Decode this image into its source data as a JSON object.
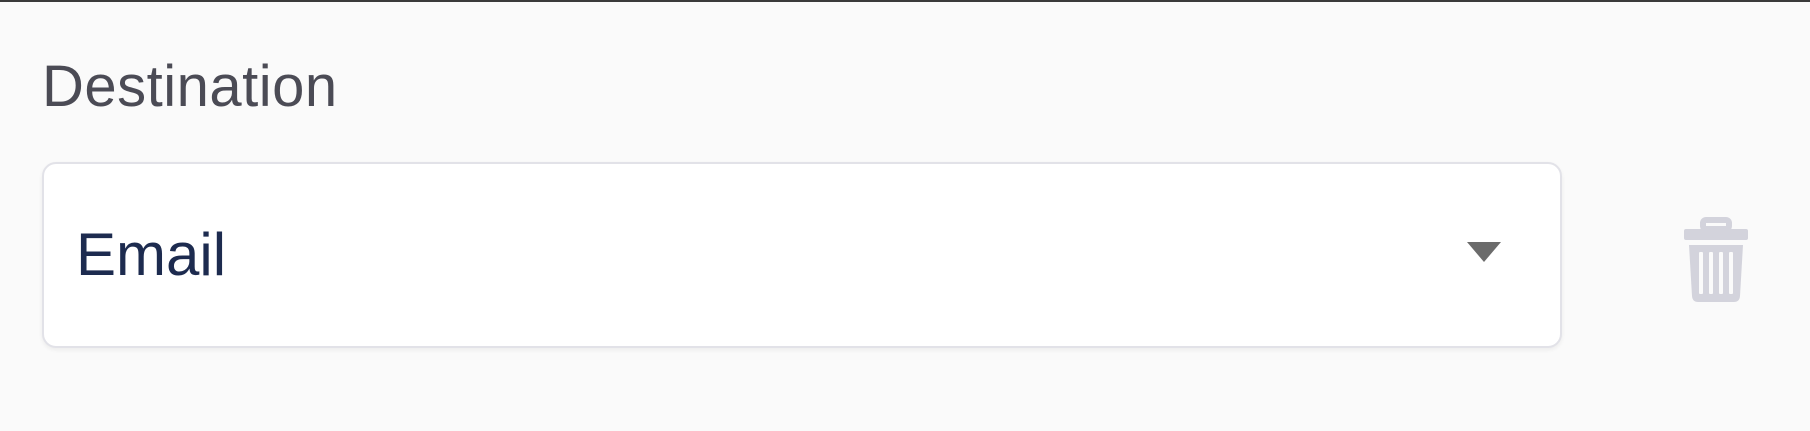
{
  "destination": {
    "label": "Destination",
    "selected_value": "Email",
    "caret_icon": "caret-down-icon",
    "delete_icon": "trash-icon"
  },
  "colors": {
    "label_text": "#4b4b55",
    "value_text": "#1d2b4f",
    "border": "#e2e2e8",
    "icon_muted": "#d3d3dc",
    "caret": "#6b6b6b"
  }
}
